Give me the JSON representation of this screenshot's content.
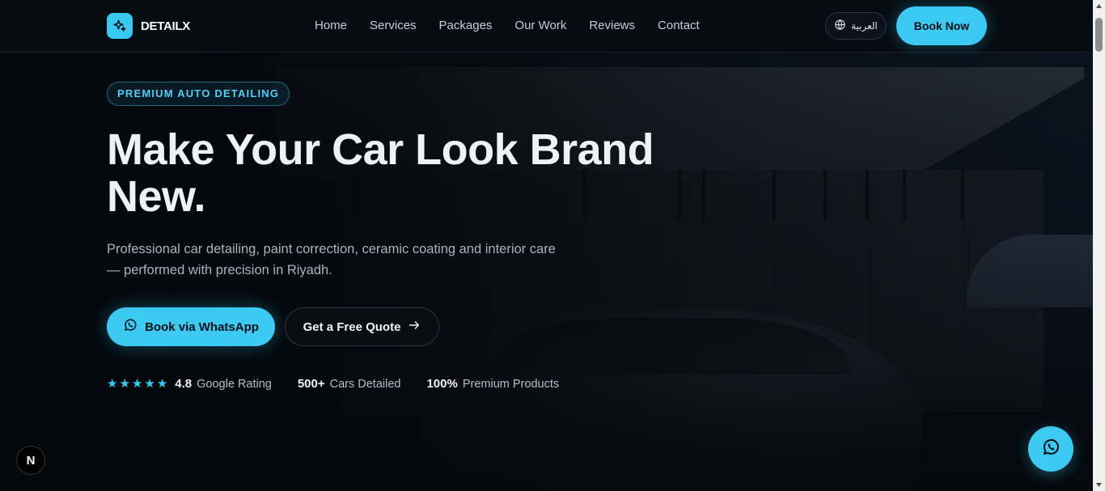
{
  "header": {
    "logo_text": "DETAILX",
    "nav": [
      "Home",
      "Services",
      "Packages",
      "Our Work",
      "Reviews",
      "Contact"
    ],
    "language_label": "العربية",
    "book_now_label": "Book Now"
  },
  "hero": {
    "badge": "PREMIUM AUTO DETAILING",
    "headline": "Make Your Car Look Brand New.",
    "subtext": "Professional car detailing, paint correction, ceramic coating and interior care — performed with precision in Riyadh.",
    "primary_cta": "Book via WhatsApp",
    "secondary_cta": "Get a Free Quote",
    "rating": {
      "stars": 5,
      "value": "4.8",
      "label": "Google Rating"
    },
    "stats": [
      {
        "value": "500+",
        "label": "Cars Detailed"
      },
      {
        "value": "100%",
        "label": "Premium Products"
      }
    ]
  },
  "floating": {
    "whatsapp_icon": "whatsapp-icon",
    "dev_badge": "N"
  },
  "colors": {
    "accent": "#3cc9f2",
    "background": "#060b12",
    "heading": "#eef1f5"
  }
}
